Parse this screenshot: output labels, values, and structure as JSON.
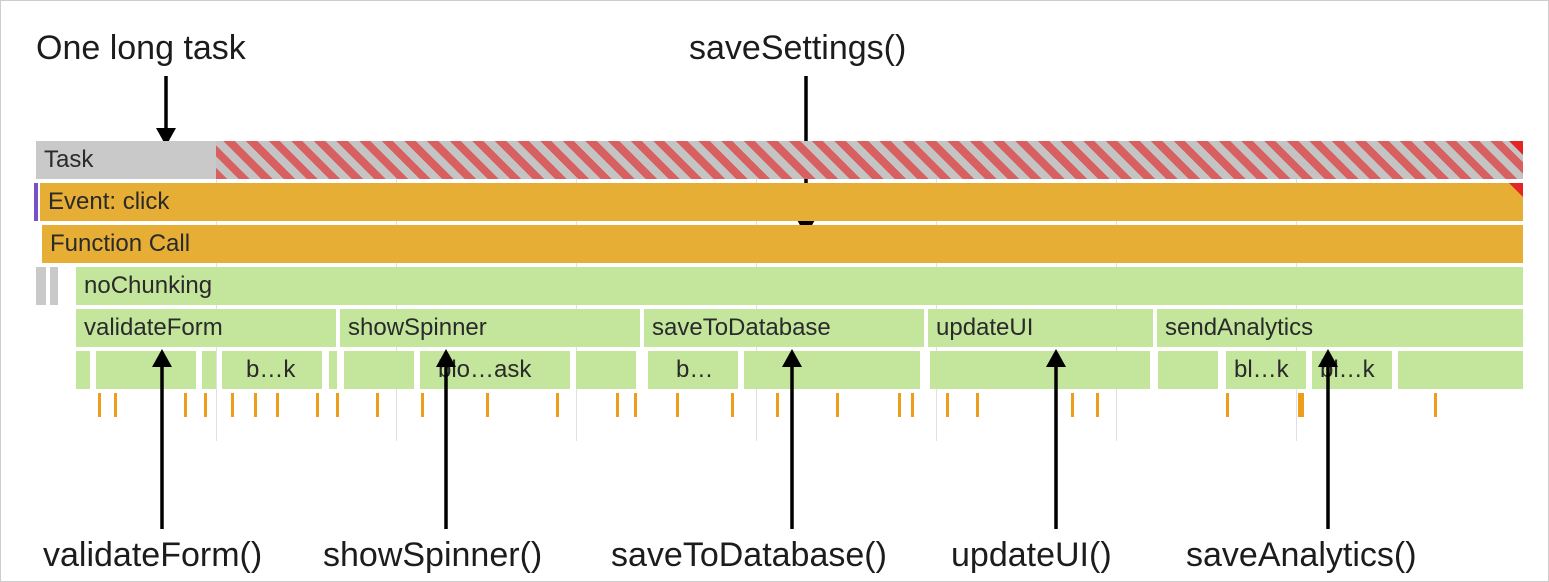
{
  "annotations": {
    "top_left": "One long task",
    "top_right": "saveSettings()",
    "bottom": {
      "validateForm": "validateForm()",
      "showSpinner": "showSpinner()",
      "saveToDatabase": "saveToDatabase()",
      "updateUI": "updateUI()",
      "saveAnalytics": "saveAnalytics()"
    }
  },
  "rows": {
    "task": "Task",
    "event": "Event: click",
    "funcCall": "Function Call",
    "noChunking": "noChunking",
    "children": {
      "validateForm": "validateForm",
      "showSpinner": "showSpinner",
      "saveToDatabase": "saveToDatabase",
      "updateUI": "updateUI",
      "sendAnalytics": "sendAnalytics"
    },
    "microLabels": {
      "bk1": "b…k",
      "bloask": "blo…ask",
      "b": "b…",
      "blk1": "bl…k",
      "blk2": "bl…k"
    }
  },
  "colors": {
    "gray": "#c9c9c9",
    "amber": "#e6ae35",
    "green": "#c3e59c",
    "hatchRed": "#d86060",
    "tick": "#ec9d1b",
    "triRed": "#e52525",
    "purple": "#7851c9"
  }
}
